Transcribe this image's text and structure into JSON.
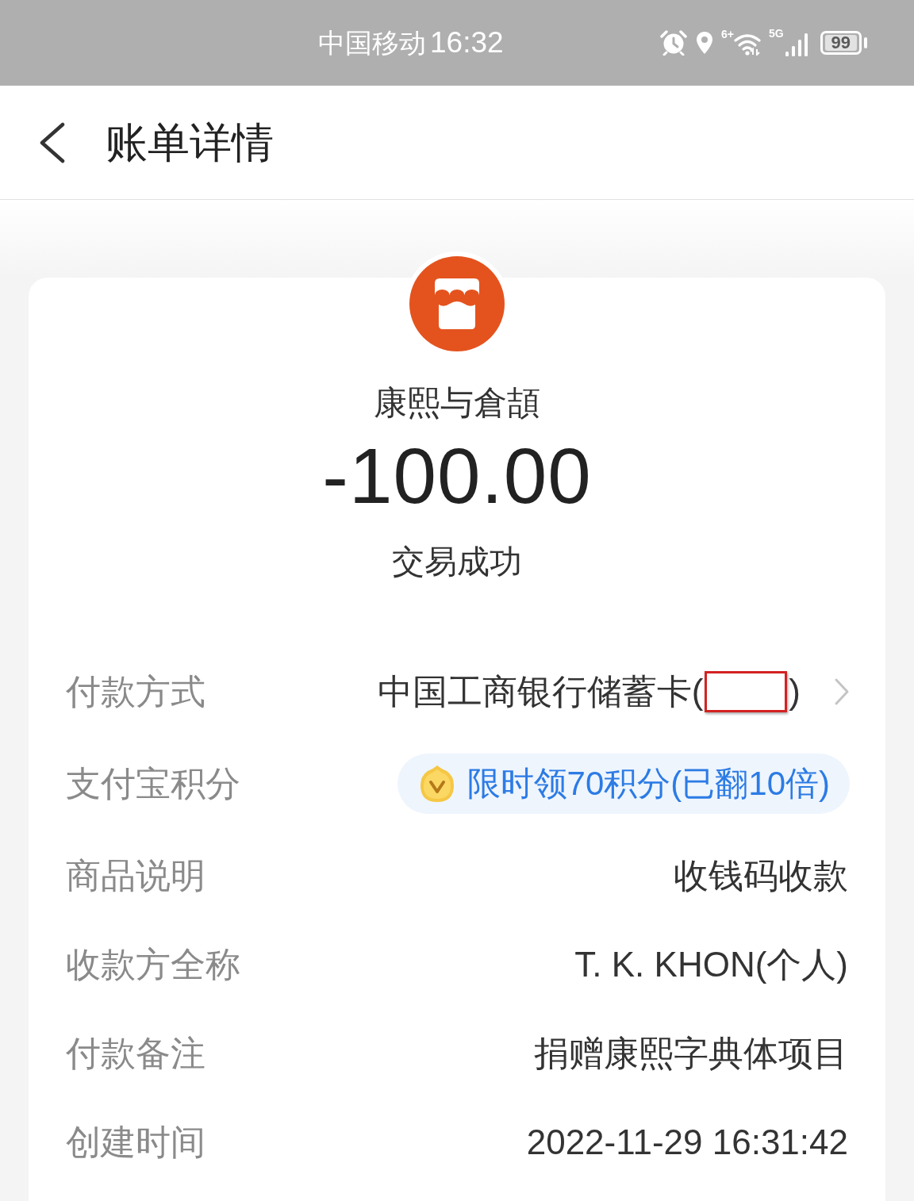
{
  "status_bar": {
    "carrier": "中国移动",
    "time": "16:32",
    "wifi_label": "6+",
    "network_label": "5G",
    "battery": "99"
  },
  "header": {
    "title": "账单详情"
  },
  "summary": {
    "merchant": "康熙与倉頡",
    "amount": "-100.00",
    "status": "交易成功"
  },
  "details": [
    {
      "kind": "card",
      "label": "付款方式",
      "value": "中国工商银行储蓄卡(",
      "value_after": ")"
    },
    {
      "kind": "promo",
      "label": "支付宝积分",
      "value": "限时领70积分(已翻10倍)"
    },
    {
      "kind": "text",
      "label": "商品说明",
      "value": "收钱码收款"
    },
    {
      "kind": "text",
      "label": "收款方全称",
      "value": "T. K. KHON(个人)"
    },
    {
      "kind": "text",
      "label": "付款备注",
      "value": "捐赠康熙字典体项目"
    },
    {
      "kind": "text",
      "label": "创建时间",
      "value": "2022-11-29 16:31:42"
    }
  ]
}
